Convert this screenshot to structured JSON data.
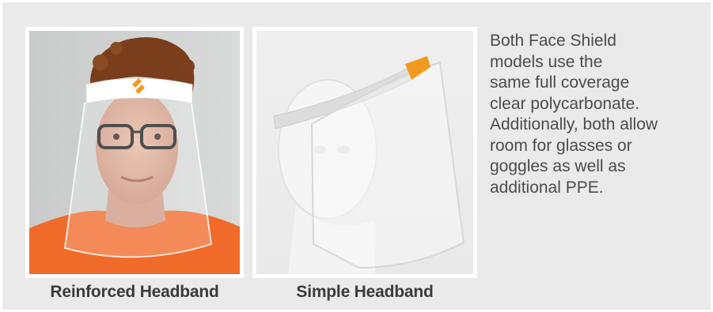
{
  "products": [
    {
      "caption": "Reinforced Headband",
      "photo": "photo-woman-wearing-reinforced-face-shield",
      "logo": "orange-logo-icon"
    },
    {
      "caption": "Simple Headband",
      "photo": "photo-mannequin-wearing-simple-face-shield",
      "label_color": "#f29a1e"
    }
  ],
  "description": {
    "lines": [
      "Both Face Shield",
      "models use the",
      "same full coverage",
      "clear polycarbonate.",
      "Additionally, both allow",
      "room for glasses or",
      "goggles as well as",
      "additional PPE."
    ]
  },
  "colors": {
    "panel": "#ebeaeb",
    "caption": "#3a3a3a",
    "body_text": "#4b4b4b",
    "shirt": "#f06a2a"
  }
}
